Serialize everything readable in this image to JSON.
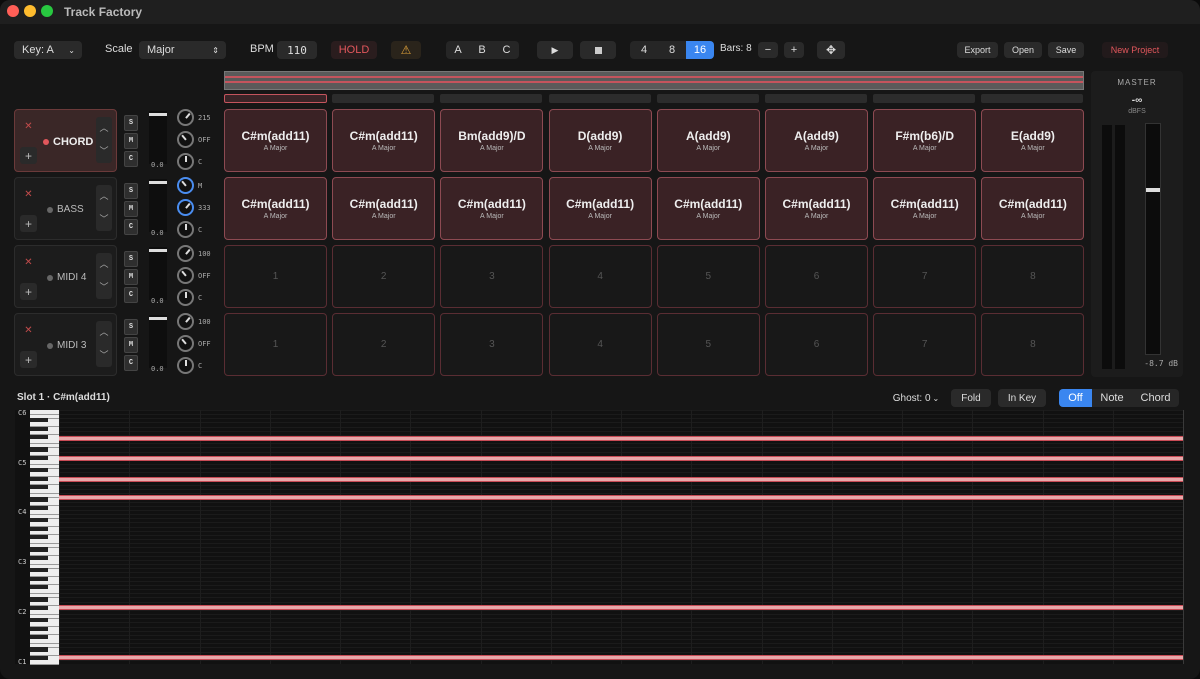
{
  "app": {
    "title": "Track Factory"
  },
  "toolbar": {
    "key_label": "Key: A",
    "scale_label": "Scale",
    "scale_value": "Major",
    "bpm_label": "BPM",
    "bpm_value": "110",
    "hold_label": "HOLD",
    "warning_icon": "warning-triangle-icon",
    "abc": [
      "A",
      "B",
      "C"
    ],
    "steps": [
      "4",
      "8",
      "16"
    ],
    "steps_selected": "16",
    "bars_label": "Bars: 8",
    "minus": "−",
    "plus": "+",
    "export": "Export",
    "open": "Open",
    "save": "Save",
    "new_project": "New Project"
  },
  "tracks": [
    {
      "name": "CHORD",
      "selected": true,
      "fader": "0.0",
      "knobs": [
        "215",
        "OFF",
        "C"
      ]
    },
    {
      "name": "BASS",
      "selected": false,
      "fader": "0.0",
      "knobs": [
        "M",
        "333",
        "C"
      ]
    },
    {
      "name": "MIDI 4",
      "selected": false,
      "fader": "0.0",
      "knobs": [
        "100",
        "OFF",
        "C"
      ]
    },
    {
      "name": "MIDI 3",
      "selected": false,
      "fader": "0.0",
      "knobs": [
        "100",
        "OFF",
        "C"
      ]
    }
  ],
  "smc": [
    "S",
    "M",
    "C"
  ],
  "grid": {
    "row1": [
      {
        "c": "C#m(add11)",
        "k": "A Major"
      },
      {
        "c": "C#m(add11)",
        "k": "A Major"
      },
      {
        "c": "Bm(add9)/D",
        "k": "A Major"
      },
      {
        "c": "D(add9)",
        "k": "A Major"
      },
      {
        "c": "A(add9)",
        "k": "A Major"
      },
      {
        "c": "A(add9)",
        "k": "A Major"
      },
      {
        "c": "F#m(b6)/D",
        "k": "A Major"
      },
      {
        "c": "E(add9)",
        "k": "A Major"
      }
    ],
    "row2": [
      {
        "c": "C#m(add11)",
        "k": "A Major"
      },
      {
        "c": "C#m(add11)",
        "k": "A Major"
      },
      {
        "c": "C#m(add11)",
        "k": "A Major"
      },
      {
        "c": "C#m(add11)",
        "k": "A Major"
      },
      {
        "c": "C#m(add11)",
        "k": "A Major"
      },
      {
        "c": "C#m(add11)",
        "k": "A Major"
      },
      {
        "c": "C#m(add11)",
        "k": "A Major"
      },
      {
        "c": "C#m(add11)",
        "k": "A Major"
      }
    ],
    "slot_numbers": [
      "1",
      "2",
      "3",
      "4",
      "5",
      "6",
      "7",
      "8"
    ]
  },
  "master": {
    "label": "MASTER",
    "peak": "-∞",
    "unit": "dBFS",
    "level": "-8.7 dB"
  },
  "editor": {
    "slot_title": "Slot 1 · C#m(add11)",
    "ghost": "Ghost: 0",
    "fold": "Fold",
    "in_key": "In Key",
    "modes": [
      "Off",
      "Note",
      "Chord"
    ],
    "mode_selected": "Off",
    "octaves": [
      "C6",
      "C5",
      "C4",
      "C3",
      "C2",
      "C1"
    ]
  }
}
